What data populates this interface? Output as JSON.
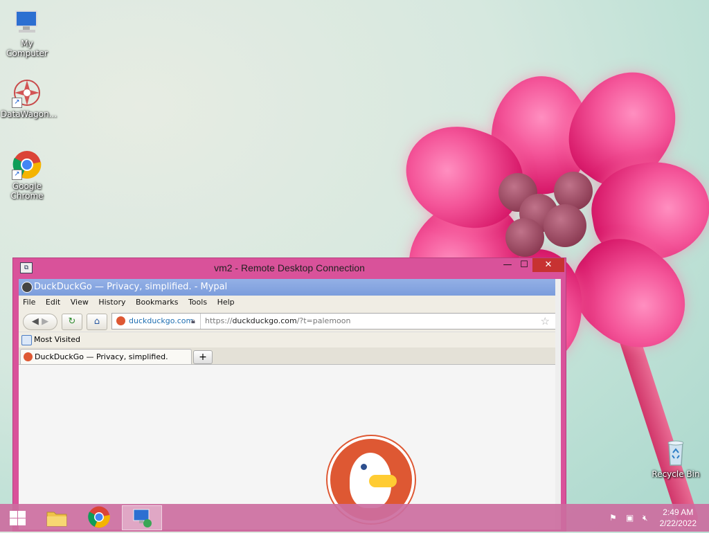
{
  "desktop": {
    "icons": [
      {
        "label": "My Computer",
        "icon": "computer-icon"
      },
      {
        "label": "DataWagon...",
        "icon": "datawagon-icon"
      },
      {
        "label": "Google Chrome",
        "icon": "chrome-icon"
      },
      {
        "label": "Recycle Bin",
        "icon": "recycle-bin-icon"
      }
    ]
  },
  "rdp_window": {
    "title": "vm2 - Remote Desktop Connection",
    "buttons": {
      "minimize": "—",
      "maximize": "☐",
      "close": "✕"
    }
  },
  "browser": {
    "title": "DuckDuckGo — Privacy, simplified. - Mypal",
    "menu": [
      "File",
      "Edit",
      "View",
      "History",
      "Bookmarks",
      "Tools",
      "Help"
    ],
    "identity": "duckduckgo.com",
    "url_prefix": "https://",
    "url_host": "duckduckgo.com",
    "url_rest": "/?t=palemoon",
    "bookmarks": {
      "most_visited": "Most Visited"
    },
    "tab": {
      "label": "DuckDuckGo — Privacy, simplified.",
      "new_tab": "+"
    }
  },
  "taskbar": {
    "apps": [
      "file-explorer-icon",
      "chrome-icon",
      "remote-desktop-icon"
    ],
    "clock_time": "2:49 AM",
    "clock_date": "2/22/2022"
  },
  "colors": {
    "ddg_orange": "#de5833",
    "window_frame": "#d9529a",
    "browser_title": "#7b9ddc"
  }
}
